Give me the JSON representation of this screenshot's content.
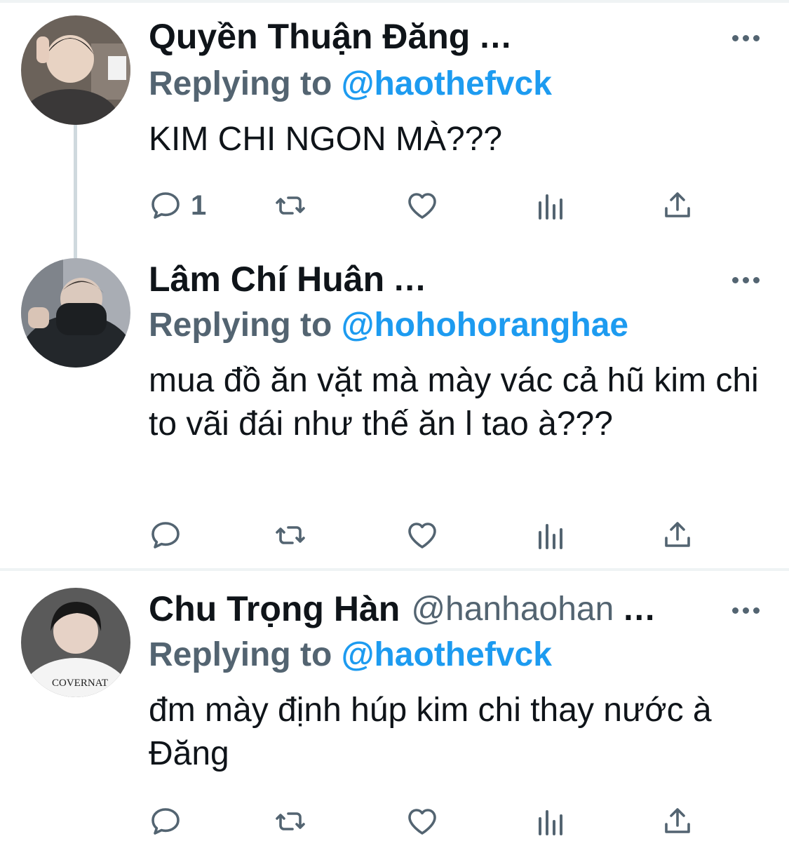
{
  "tweets": [
    {
      "name": "Quyền Thuận Đăng",
      "handle": "",
      "ellipsis": "...",
      "reply_prefix": "Replying to",
      "reply_to": "@haothefvck",
      "text": "KIM CHI NGON MÀ???",
      "reply_count": "1",
      "avatar_colors": [
        "#5b5550",
        "#e9d5c6",
        "#2b2a2a"
      ]
    },
    {
      "name": "Lâm Chí Huân",
      "handle": "",
      "ellipsis": "...",
      "reply_prefix": "Replying to",
      "reply_to": "@hohohoranghae",
      "text": "mua đồ ăn vặt mà mày vác cả hũ kim chi to vãi đái như thế ăn l tao à???",
      "reply_count": "",
      "avatar_colors": [
        "#9a9ea6",
        "#d8c7bd",
        "#1f2225"
      ]
    },
    {
      "name": "Chu Trọng Hàn",
      "handle": "@hanhaohan",
      "ellipsis": "...",
      "reply_prefix": "Replying to",
      "reply_to": "@haothefvck",
      "text": "đm mày định húp kim chi thay nước à Đăng",
      "reply_count": "",
      "avatar_colors": [
        "#595959",
        "#e3cfc3",
        "#f5f5f5"
      ]
    }
  ],
  "icons": [
    "reply-icon",
    "retweet-icon",
    "like-icon",
    "views-icon",
    "share-icon",
    "more-icon"
  ],
  "colors": {
    "accent": "#1d9bf0",
    "secondary_text": "#536471",
    "primary_text": "#0f1419",
    "divider": "#eff3f4"
  }
}
